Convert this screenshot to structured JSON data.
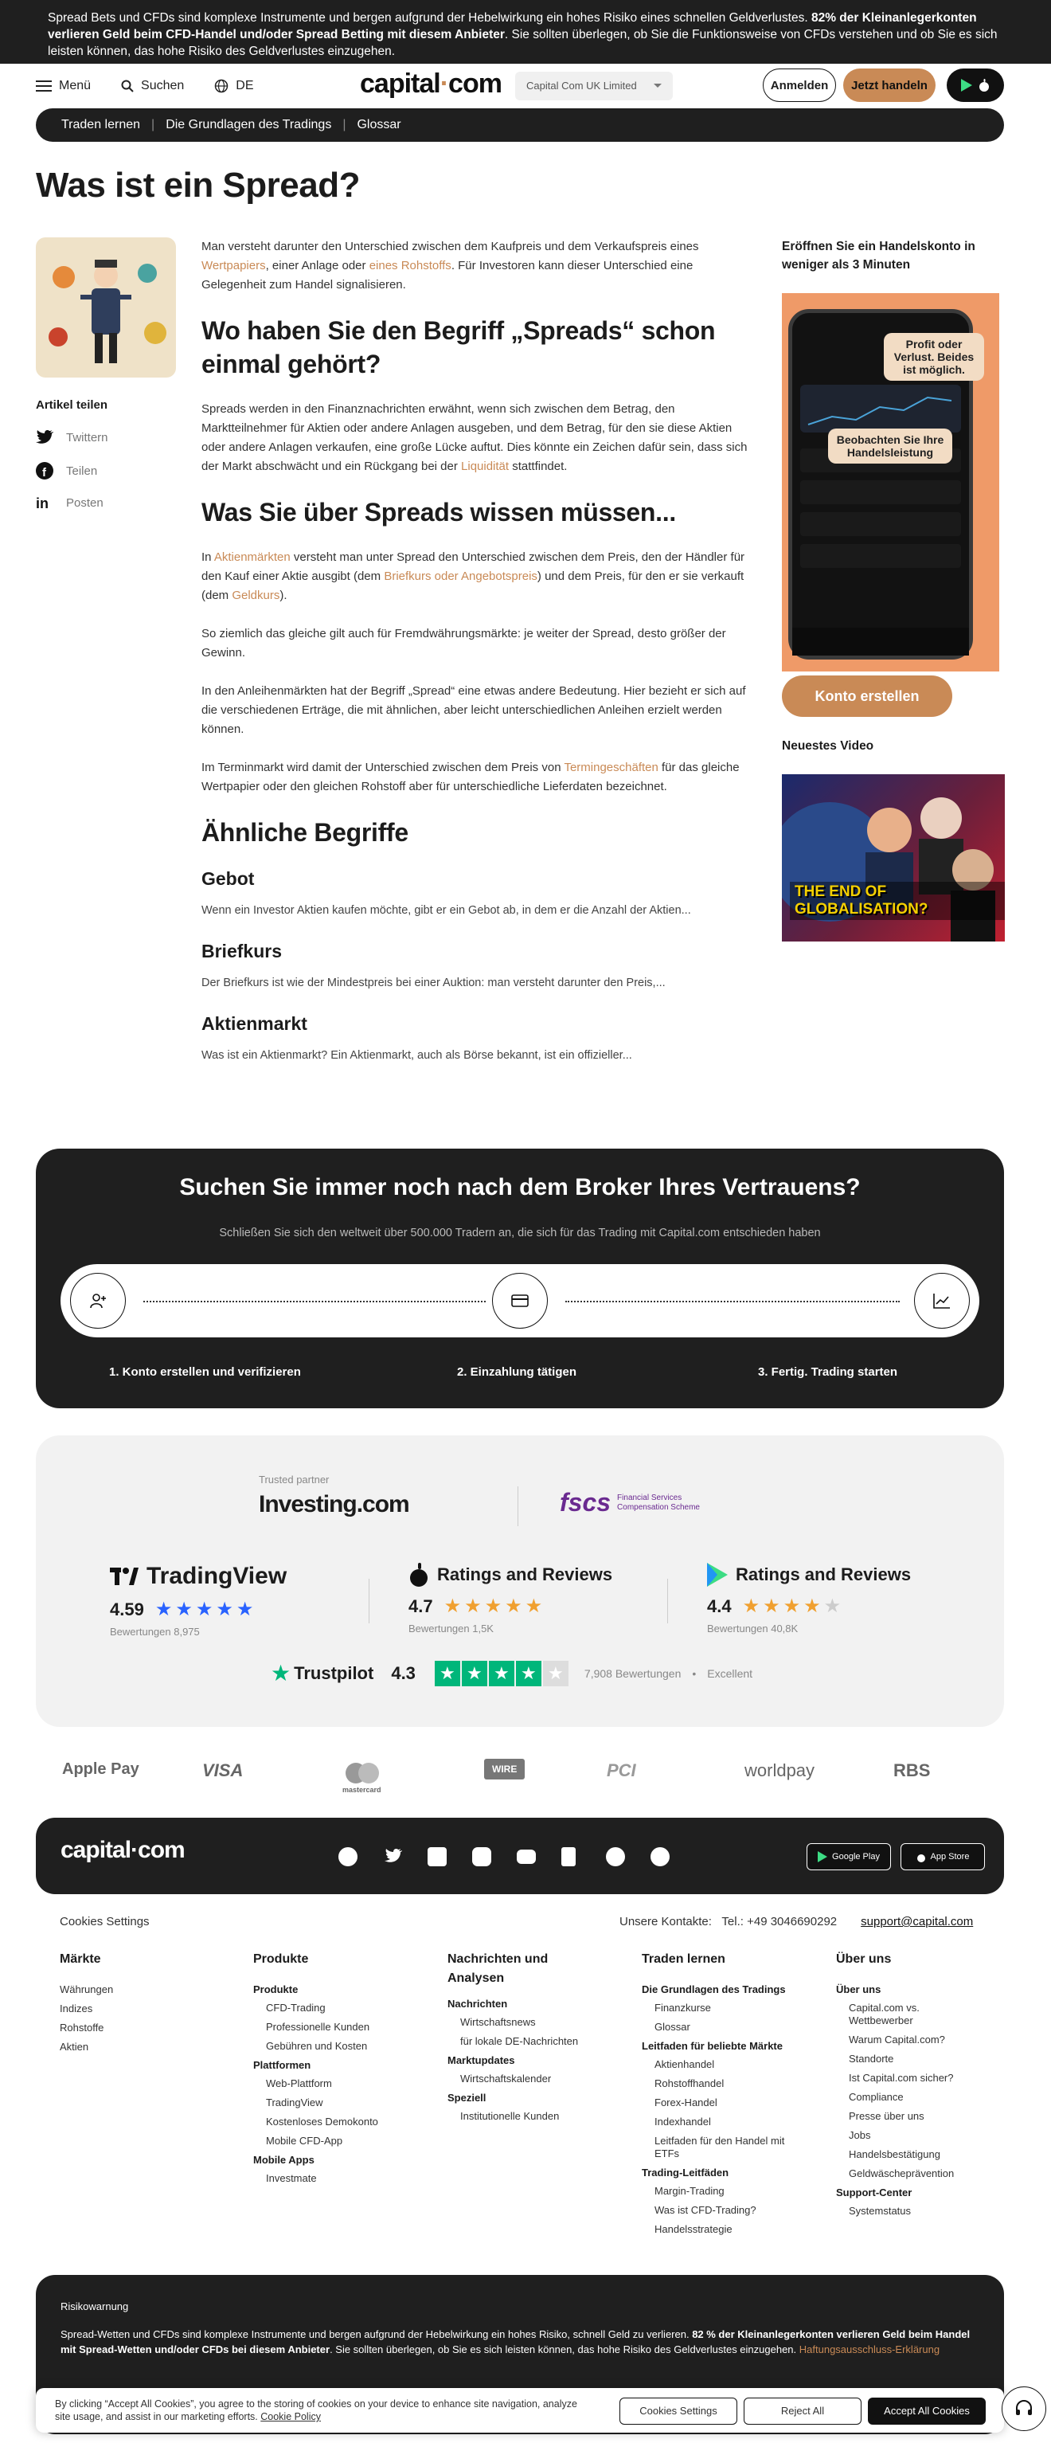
{
  "risk_banner": {
    "text_1": "Spread Bets und CFDs sind komplexe Instrumente und bergen aufgrund der Hebelwirkung ein hohes Risiko eines schnellen Geldverlustes. ",
    "bold_1": "82% der Kleinanlegerkonten verlieren Geld beim CFD-Handel und/oder Spread Betting mit diesem Anbieter",
    "text_2": ". Sie sollten überlegen, ob Sie die Funktionsweise von CFDs verstehen und ob Sie es sich leisten können, das hohe Risiko des Geldverlustes einzugehen."
  },
  "header": {
    "menu": "Menü",
    "search": "Suchen",
    "language": "DE",
    "logo_a": "capital",
    "logo_dot": "·",
    "logo_b": "com",
    "entity": "Capital Com UK Limited",
    "login": "Anmelden",
    "trade": "Jetzt handeln"
  },
  "breadcrumbs": [
    "Traden lernen",
    "Die Grundlagen des Tradings",
    "Glossar"
  ],
  "title": "Was ist ein Spread?",
  "share": {
    "heading": "Artikel teilen",
    "twitter": "Twittern",
    "facebook": "Teilen",
    "linkedin": "Posten"
  },
  "article": {
    "intro_a": "Man versteht darunter den Unterschied zwischen dem Kaufpreis und dem Verkaufspreis eines ",
    "intro_link1": "Wertpapiers",
    "intro_b": ", einer Anlage oder ",
    "intro_link2": "eines Rohstoffs",
    "intro_c": ". Für Investoren kann dieser Unterschied eine Gelegenheit zum Handel signalisieren.",
    "h_where": "Wo haben Sie den Begriff „Spreads“ schon einmal gehört?",
    "where_a": "Spreads werden in den Finanznachrichten erwähnt, wenn sich zwischen dem Betrag, den Marktteilnehmer für Aktien oder andere Anlagen ausgeben, und dem Betrag, für den sie diese Aktien oder andere Anlagen verkaufen, eine große Lücke auftut. Dies könnte ein Zeichen dafür sein, dass sich der Markt abschwächt und ein Rückgang bei der ",
    "where_link": "Liquidität",
    "where_b": " stattfindet.",
    "h_know": "Was Sie über Spreads wissen müssen...",
    "know1_a": "In ",
    "know1_link1": "Aktienmärkten",
    "know1_b": " versteht man unter Spread den Unterschied zwischen dem Preis, den der Händler für den Kauf einer Aktie ausgibt (dem ",
    "know1_link2": "Briefkurs oder Angebotspreis",
    "know1_c": ") und dem Preis, für den er sie verkauft (dem ",
    "know1_link3": "Geldkurs",
    "know1_d": ").",
    "know2": "So ziemlich das gleiche gilt auch für Fremdwährungsmärkte: je weiter der Spread, desto größer der Gewinn.",
    "know3": "In den Anleihenmärkten hat der Begriff „Spread“ eine etwas andere Bedeutung. Hier bezieht er sich auf die verschiedenen Erträge, die mit ähnlichen, aber leicht unterschiedlichen Anleihen erzielt werden können.",
    "know4_a": "Im Terminmarkt wird damit der Unterschied zwischen dem Preis von ",
    "know4_link": "Termingeschäften",
    "know4_b": " für das gleiche Wertpapier oder den gleichen Rohstoff aber für unterschiedliche Lieferdaten bezeichnet.",
    "h_related": "Ähnliche Begriffe",
    "related": [
      {
        "term": "Gebot",
        "snippet": "Wenn ein Investor Aktien kaufen möchte, gibt er ein Gebot ab, in dem er die Anzahl der Aktien..."
      },
      {
        "term": "Briefkurs",
        "snippet": "Der Briefkurs ist wie der Mindestpreis bei einer Auktion: man versteht darunter den Preis,..."
      },
      {
        "term": "Aktienmarkt",
        "snippet": "Was ist ein Aktienmarkt? Ein Aktienmarkt, auch als Börse bekannt, ist ein offizieller..."
      }
    ]
  },
  "sidebar": {
    "promo_heading": "Eröffnen Sie ein Handelskonto in weniger als 3 Minuten",
    "bubble_1": "Profit oder Verlust. Beides ist möglich.",
    "bubble_2": "Beobachten Sie Ihre Handelsleistung",
    "cta": "Konto erstellen",
    "video_heading": "Neuestes Video",
    "video_caption": "THE END OF GLOBALISATION?"
  },
  "broker": {
    "heading": "Suchen Sie immer noch nach dem Broker Ihres Vertrauens?",
    "sub": "Schließen Sie sich den weltweit über 500.000 Tradern an, die sich für das Trading mit Capital.com entschieden haben",
    "steps": [
      "1. Konto erstellen und verifizieren",
      "2. Einzahlung tätigen",
      "3. Fertig. Trading starten"
    ]
  },
  "partners": {
    "trusted": "Trusted partner",
    "investing": "Investing.com",
    "fscs": "fscs",
    "fscs_sub": "Financial Services Compensation Scheme",
    "ratings": [
      {
        "name": "TradingView",
        "score": "4.59",
        "count": "Bewertungen 8,975"
      },
      {
        "name": "Ratings and Reviews",
        "score": "4.7",
        "count": "Bewertungen 1,5K"
      },
      {
        "name": "Ratings and Reviews",
        "score": "4.4",
        "count": "Bewertungen 40,8K"
      }
    ],
    "trustpilot": "Trustpilot",
    "trustpilot_score": "4.3",
    "trustpilot_count": "7,908 Bewertungen",
    "trustpilot_label": "Excellent"
  },
  "payments": [
    "Apple Pay",
    "VISA",
    "mastercard",
    "WIRE",
    "PCI",
    "worldpay",
    "RBS"
  ],
  "footer": {
    "logo": "capital·com",
    "store_google": "Google Play",
    "store_apple": "App Store",
    "cookies": "Cookies Settings",
    "contacts_label": "Unsere Kontakte:",
    "phone": "Tel.: +49 3046690292",
    "email": "support@capital.com",
    "columns": {
      "markets": {
        "h": "Märkte",
        "items": [
          "Währungen",
          "Indizes",
          "Rohstoffe",
          "Aktien"
        ]
      },
      "products": {
        "h": "Produkte",
        "s1": "Produkte",
        "i1": [
          "CFD-Trading",
          "Professionelle Kunden",
          "Gebühren und Kosten"
        ],
        "s2": "Plattformen",
        "i2": [
          "Web-Plattform",
          "TradingView",
          "Kostenloses Demokonto",
          "Mobile CFD-App"
        ],
        "s3": "Mobile Apps",
        "i3": [
          "Investmate"
        ]
      },
      "news": {
        "h": "Nachrichten und Analysen",
        "s1": "Nachrichten",
        "i1": [
          "Wirtschaftsnews",
          "für lokale DE-Nachrichten"
        ],
        "s2": "Marktupdates",
        "i2": [
          "Wirtschaftskalender"
        ],
        "s3": "Speziell",
        "i3": [
          "Institutionelle Kunden"
        ]
      },
      "learn": {
        "h": "Traden lernen",
        "s1": "Die Grundlagen des Tradings",
        "i1": [
          "Finanzkurse",
          "Glossar"
        ],
        "s2": "Leitfaden für beliebte Märkte",
        "i2": [
          "Aktienhandel",
          "Rohstoffhandel",
          "Forex-Handel",
          "Indexhandel",
          "Leitfaden für den Handel mit ETFs"
        ],
        "s3": "Trading-Leitfäden",
        "i3": [
          "Margin-Trading",
          "Was ist CFD-Trading?",
          "Handelsstrategie"
        ]
      },
      "about": {
        "h": "Über uns",
        "s1": "Über uns",
        "i1": [
          "Capital.com vs. Wettbewerber",
          "Warum Capital.com?",
          "Standorte",
          "Ist Capital.com sicher?",
          "Compliance",
          "Presse über uns",
          "Jobs",
          "Handelsbestätigung",
          "Geldwäscheprävention"
        ],
        "s2": "Support-Center",
        "i2": [
          "Systemstatus"
        ]
      }
    }
  },
  "warning": {
    "heading": "Risikowarnung",
    "text_a": "Spread-Wetten und CFDs sind komplexe Instrumente und bergen aufgrund der Hebelwirkung ein hohes Risiko, schnell Geld zu verlieren. ",
    "bold": "82 % der Kleinanlegerkonten verlieren Geld beim Handel mit Spread-Wetten und/oder CFDs bei diesem Anbieter",
    "text_b": ". Sie sollten überlegen, ob Sie es sich leisten können, das hohe Risiko des Geldverlustes einzugehen. ",
    "link": "Haftungsausschluss-Erklärung"
  },
  "cookie": {
    "text": "By clicking “Accept All Cookies”, you agree to the storing of cookies on your device to enhance site navigation, analyze site usage, and assist in our marketing efforts.",
    "policy": "Cookie Policy",
    "settings": "Cookies Settings",
    "reject": "Reject All",
    "accept": "Accept All Cookies"
  }
}
